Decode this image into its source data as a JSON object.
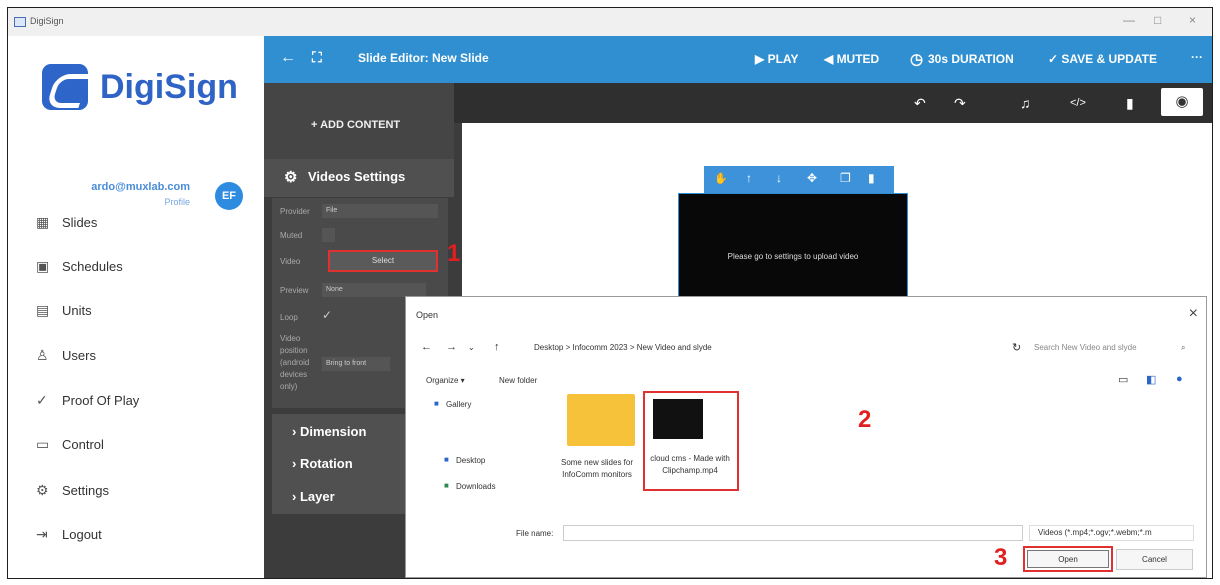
{
  "window": {
    "title": "DigiSign",
    "minimize": "—",
    "maximize": "□",
    "close": "×"
  },
  "brand": {
    "logo_text": "DigiSign",
    "color": "#2f63c5"
  },
  "user": {
    "email": "ardo@muxlab.com",
    "profile": "Profile",
    "initials": "EF"
  },
  "nav": [
    {
      "label": "Slides",
      "icon": "slides-icon",
      "glyph": "▦"
    },
    {
      "label": "Schedules",
      "icon": "calendar-icon",
      "glyph": "▣"
    },
    {
      "label": "Units",
      "icon": "units-icon",
      "glyph": "▤"
    },
    {
      "label": "Users",
      "icon": "users-icon",
      "glyph": "♙"
    },
    {
      "label": "Proof Of Play",
      "icon": "proof-icon",
      "glyph": "✓"
    },
    {
      "label": "Control",
      "icon": "monitor-icon",
      "glyph": "▭"
    },
    {
      "label": "Settings",
      "icon": "settings-icon",
      "glyph": "⚙"
    },
    {
      "label": "Logout",
      "icon": "logout-icon",
      "glyph": "⇥"
    }
  ],
  "editor": {
    "title": "Slide Editor: New Slide",
    "play": "▶ PLAY",
    "muted": "◀ MUTED",
    "duration": "30s DURATION",
    "save": "✓ SAVE & UPDATE",
    "more": "···",
    "add_content": "+ ADD CONTENT",
    "video_settings": "Videos Settings",
    "dimension": "› Dimension",
    "rotation": "› Rotation",
    "layer": "› Layer",
    "placeholder": "Please go to settings to upload video"
  },
  "settings": {
    "provider_label": "Provider",
    "provider_value": "File",
    "muted_label": "Muted",
    "video_label": "Video",
    "select_label": "Select",
    "preview_label": "Preview",
    "preview_value": "None",
    "loop_label": "Loop",
    "position_label": "Video position (android devices only)",
    "position_value": "Bring to front"
  },
  "dialog": {
    "title": "Open",
    "path": "Desktop > Infocomm 2023 > New Video and slyde",
    "search": "Search New Video and slyde",
    "organize": "Organize ▾",
    "new_folder": "New folder",
    "nav_gallery": "Gallery",
    "nav_desktop": "Desktop",
    "nav_downloads": "Downloads",
    "folder_name": "Some new slides for InfoComm monitors",
    "video_file": "cloud cms - Made with Clipchamp.mp4",
    "filename_label": "File name:",
    "filter": "Videos (*.mp4;*.ogv;*.webm;*.m",
    "open": "Open",
    "cancel": "Cancel"
  },
  "annotations": {
    "one": "1",
    "two": "2",
    "three": "3"
  }
}
